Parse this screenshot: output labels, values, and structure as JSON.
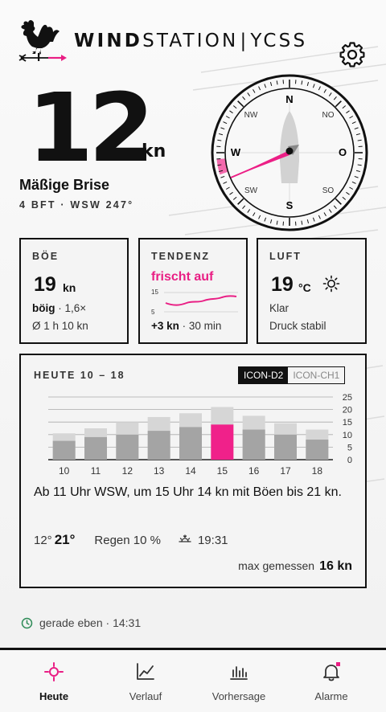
{
  "header": {
    "brand_bold": "WIND",
    "brand_rest": "STATION",
    "brand_sep": "|",
    "brand_club": "YCSS"
  },
  "current": {
    "speed": "12",
    "unit": "kn",
    "description": "Mäßige Brise",
    "sub": "4 BFT · WSW 247°",
    "direction_deg": 247
  },
  "compass": {
    "n": "N",
    "s": "S",
    "e": "O",
    "w": "W",
    "nw": "NW",
    "no": "NO",
    "sw": "SW",
    "so": "SO"
  },
  "gusts": {
    "label": "BÖE",
    "value": "19",
    "unit": "kn",
    "character": "böig",
    "factor": " · 1,6×",
    "avg": "Ø 1 h 10 kn"
  },
  "trend": {
    "label": "TENDENZ",
    "title": "frischt auf",
    "axis_top": "15",
    "axis_bottom": "5",
    "delta": "+3 kn",
    "window": " · 30 min"
  },
  "air": {
    "label": "LUFT",
    "temp": "19",
    "unit": "°C",
    "sky": "Klar",
    "pressure": "Druck stabil",
    "icon": "sun-icon"
  },
  "forecast": {
    "label": "HEUTE 10 – 18",
    "models": [
      "ICON-D2",
      "ICON-CH1"
    ],
    "active_model": "ICON-D2",
    "text": "Ab 11 Uhr WSW, um 15 Uhr 14 kn mit Böen bis 21 kn.",
    "temp_min": "12°",
    "temp_max": "21°",
    "rain": "Regen 10 %",
    "sunset": "19:31",
    "max_measured_label": "max gemessen",
    "max_measured_value": "16 kn"
  },
  "chart_data": {
    "type": "bar",
    "categories": [
      "10",
      "11",
      "12",
      "13",
      "14",
      "15",
      "16",
      "17",
      "18"
    ],
    "series": [
      {
        "values": [
          7.5,
          9,
          10,
          11.5,
          13,
          14,
          12,
          10,
          8
        ]
      },
      {
        "values": [
          10.5,
          12.5,
          15,
          17,
          18.5,
          21,
          17.5,
          14.5,
          12
        ]
      }
    ],
    "highlight_index": 5,
    "ylim": [
      0,
      25
    ],
    "yticks": [
      "25",
      "20",
      "15",
      "10",
      "5",
      "0"
    ],
    "grid": true,
    "colors": {
      "wind": "#a4a4a4",
      "gust": "#d6d6d6",
      "highlight": "#f0218a"
    }
  },
  "status": {
    "updated": "gerade eben · 14:31"
  },
  "nav": {
    "items": [
      {
        "label": "Heute"
      },
      {
        "label": "Verlauf"
      },
      {
        "label": "Vorhersage"
      },
      {
        "label": "Alarme"
      }
    ]
  },
  "colors": {
    "accent": "#e91e84",
    "ink": "#111111",
    "background": "#f3f3f3"
  }
}
